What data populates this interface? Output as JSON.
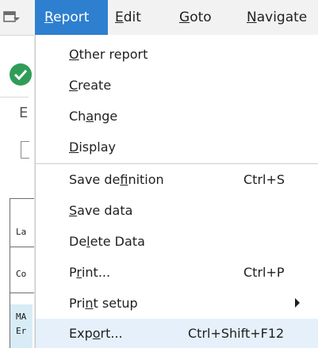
{
  "menubar": {
    "app_icon": "menu-toggle-icon",
    "items": [
      {
        "mnemonic": "R",
        "rest": "eport"
      },
      {
        "mnemonic": "E",
        "rest": "dit"
      },
      {
        "mnemonic": "G",
        "rest": "oto"
      },
      {
        "mnemonic": "N",
        "rest": "avigate"
      }
    ]
  },
  "background": {
    "status_icon": "check-circle-icon",
    "label_fragment": "E",
    "grid_cells": [
      "La",
      "Co",
      "MA",
      "Er"
    ]
  },
  "dropdown": {
    "items": [
      {
        "pre": "",
        "mn": "O",
        "post": "ther report",
        "accel": ""
      },
      {
        "pre": "",
        "mn": "C",
        "post": "reate",
        "accel": ""
      },
      {
        "pre": "Ch",
        "mn": "a",
        "post": "nge",
        "accel": ""
      },
      {
        "pre": "",
        "mn": "D",
        "post": "isplay",
        "accel": ""
      },
      {
        "pre": "Save de",
        "mn": "f",
        "post": "inition",
        "accel": "Ctrl+S"
      },
      {
        "pre": "",
        "mn": "S",
        "post": "ave data",
        "accel": ""
      },
      {
        "pre": "De",
        "mn": "l",
        "post": "ete Data",
        "accel": ""
      },
      {
        "pre": "P",
        "mn": "r",
        "post": "int...",
        "accel": "Ctrl+P"
      },
      {
        "pre": "Pri",
        "mn": "n",
        "post": "t setup",
        "accel": ""
      },
      {
        "pre": "Exp",
        "mn": "o",
        "post": "rt...",
        "accel": "Ctrl+Shift+F12"
      }
    ]
  },
  "colors": {
    "menu_active": "#2e7fcf",
    "hover_row": "#e5f0fb",
    "status_green": "#2f9d57"
  }
}
